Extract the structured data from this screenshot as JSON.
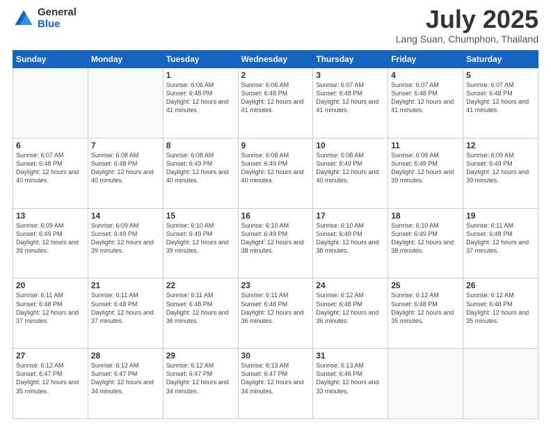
{
  "logo": {
    "general": "General",
    "blue": "Blue"
  },
  "title": "July 2025",
  "location": "Lang Suan, Chumphon, Thailand",
  "days_of_week": [
    "Sunday",
    "Monday",
    "Tuesday",
    "Wednesday",
    "Thursday",
    "Friday",
    "Saturday"
  ],
  "weeks": [
    [
      {
        "day": "",
        "info": ""
      },
      {
        "day": "",
        "info": ""
      },
      {
        "day": "1",
        "info": "Sunrise: 6:06 AM\nSunset: 6:48 PM\nDaylight: 12 hours and 41 minutes."
      },
      {
        "day": "2",
        "info": "Sunrise: 6:06 AM\nSunset: 6:48 PM\nDaylight: 12 hours and 41 minutes."
      },
      {
        "day": "3",
        "info": "Sunrise: 6:07 AM\nSunset: 6:48 PM\nDaylight: 12 hours and 41 minutes."
      },
      {
        "day": "4",
        "info": "Sunrise: 6:07 AM\nSunset: 6:48 PM\nDaylight: 12 hours and 41 minutes."
      },
      {
        "day": "5",
        "info": "Sunrise: 6:07 AM\nSunset: 6:48 PM\nDaylight: 12 hours and 41 minutes."
      }
    ],
    [
      {
        "day": "6",
        "info": "Sunrise: 6:07 AM\nSunset: 6:48 PM\nDaylight: 12 hours and 40 minutes."
      },
      {
        "day": "7",
        "info": "Sunrise: 6:08 AM\nSunset: 6:48 PM\nDaylight: 12 hours and 40 minutes."
      },
      {
        "day": "8",
        "info": "Sunrise: 6:08 AM\nSunset: 6:49 PM\nDaylight: 12 hours and 40 minutes."
      },
      {
        "day": "9",
        "info": "Sunrise: 6:08 AM\nSunset: 6:49 PM\nDaylight: 12 hours and 40 minutes."
      },
      {
        "day": "10",
        "info": "Sunrise: 6:08 AM\nSunset: 6:49 PM\nDaylight: 12 hours and 40 minutes."
      },
      {
        "day": "11",
        "info": "Sunrise: 6:09 AM\nSunset: 6:49 PM\nDaylight: 12 hours and 39 minutes."
      },
      {
        "day": "12",
        "info": "Sunrise: 6:09 AM\nSunset: 6:49 PM\nDaylight: 12 hours and 39 minutes."
      }
    ],
    [
      {
        "day": "13",
        "info": "Sunrise: 6:09 AM\nSunset: 6:49 PM\nDaylight: 12 hours and 39 minutes."
      },
      {
        "day": "14",
        "info": "Sunrise: 6:09 AM\nSunset: 6:49 PM\nDaylight: 12 hours and 39 minutes."
      },
      {
        "day": "15",
        "info": "Sunrise: 6:10 AM\nSunset: 6:49 PM\nDaylight: 12 hours and 39 minutes."
      },
      {
        "day": "16",
        "info": "Sunrise: 6:10 AM\nSunset: 6:49 PM\nDaylight: 12 hours and 38 minutes."
      },
      {
        "day": "17",
        "info": "Sunrise: 6:10 AM\nSunset: 6:49 PM\nDaylight: 12 hours and 38 minutes."
      },
      {
        "day": "18",
        "info": "Sunrise: 6:10 AM\nSunset: 6:49 PM\nDaylight: 12 hours and 38 minutes."
      },
      {
        "day": "19",
        "info": "Sunrise: 6:11 AM\nSunset: 6:48 PM\nDaylight: 12 hours and 37 minutes."
      }
    ],
    [
      {
        "day": "20",
        "info": "Sunrise: 6:11 AM\nSunset: 6:48 PM\nDaylight: 12 hours and 37 minutes."
      },
      {
        "day": "21",
        "info": "Sunrise: 6:11 AM\nSunset: 6:48 PM\nDaylight: 12 hours and 37 minutes."
      },
      {
        "day": "22",
        "info": "Sunrise: 6:11 AM\nSunset: 6:48 PM\nDaylight: 12 hours and 36 minutes."
      },
      {
        "day": "23",
        "info": "Sunrise: 6:11 AM\nSunset: 6:48 PM\nDaylight: 12 hours and 36 minutes."
      },
      {
        "day": "24",
        "info": "Sunrise: 6:12 AM\nSunset: 6:48 PM\nDaylight: 12 hours and 36 minutes."
      },
      {
        "day": "25",
        "info": "Sunrise: 6:12 AM\nSunset: 6:48 PM\nDaylight: 12 hours and 35 minutes."
      },
      {
        "day": "26",
        "info": "Sunrise: 6:12 AM\nSunset: 6:48 PM\nDaylight: 12 hours and 35 minutes."
      }
    ],
    [
      {
        "day": "27",
        "info": "Sunrise: 6:12 AM\nSunset: 6:47 PM\nDaylight: 12 hours and 35 minutes."
      },
      {
        "day": "28",
        "info": "Sunrise: 6:12 AM\nSunset: 6:47 PM\nDaylight: 12 hours and 34 minutes."
      },
      {
        "day": "29",
        "info": "Sunrise: 6:12 AM\nSunset: 6:47 PM\nDaylight: 12 hours and 34 minutes."
      },
      {
        "day": "30",
        "info": "Sunrise: 6:13 AM\nSunset: 6:47 PM\nDaylight: 12 hours and 34 minutes."
      },
      {
        "day": "31",
        "info": "Sunrise: 6:13 AM\nSunset: 6:46 PM\nDaylight: 12 hours and 33 minutes."
      },
      {
        "day": "",
        "info": ""
      },
      {
        "day": "",
        "info": ""
      }
    ]
  ]
}
